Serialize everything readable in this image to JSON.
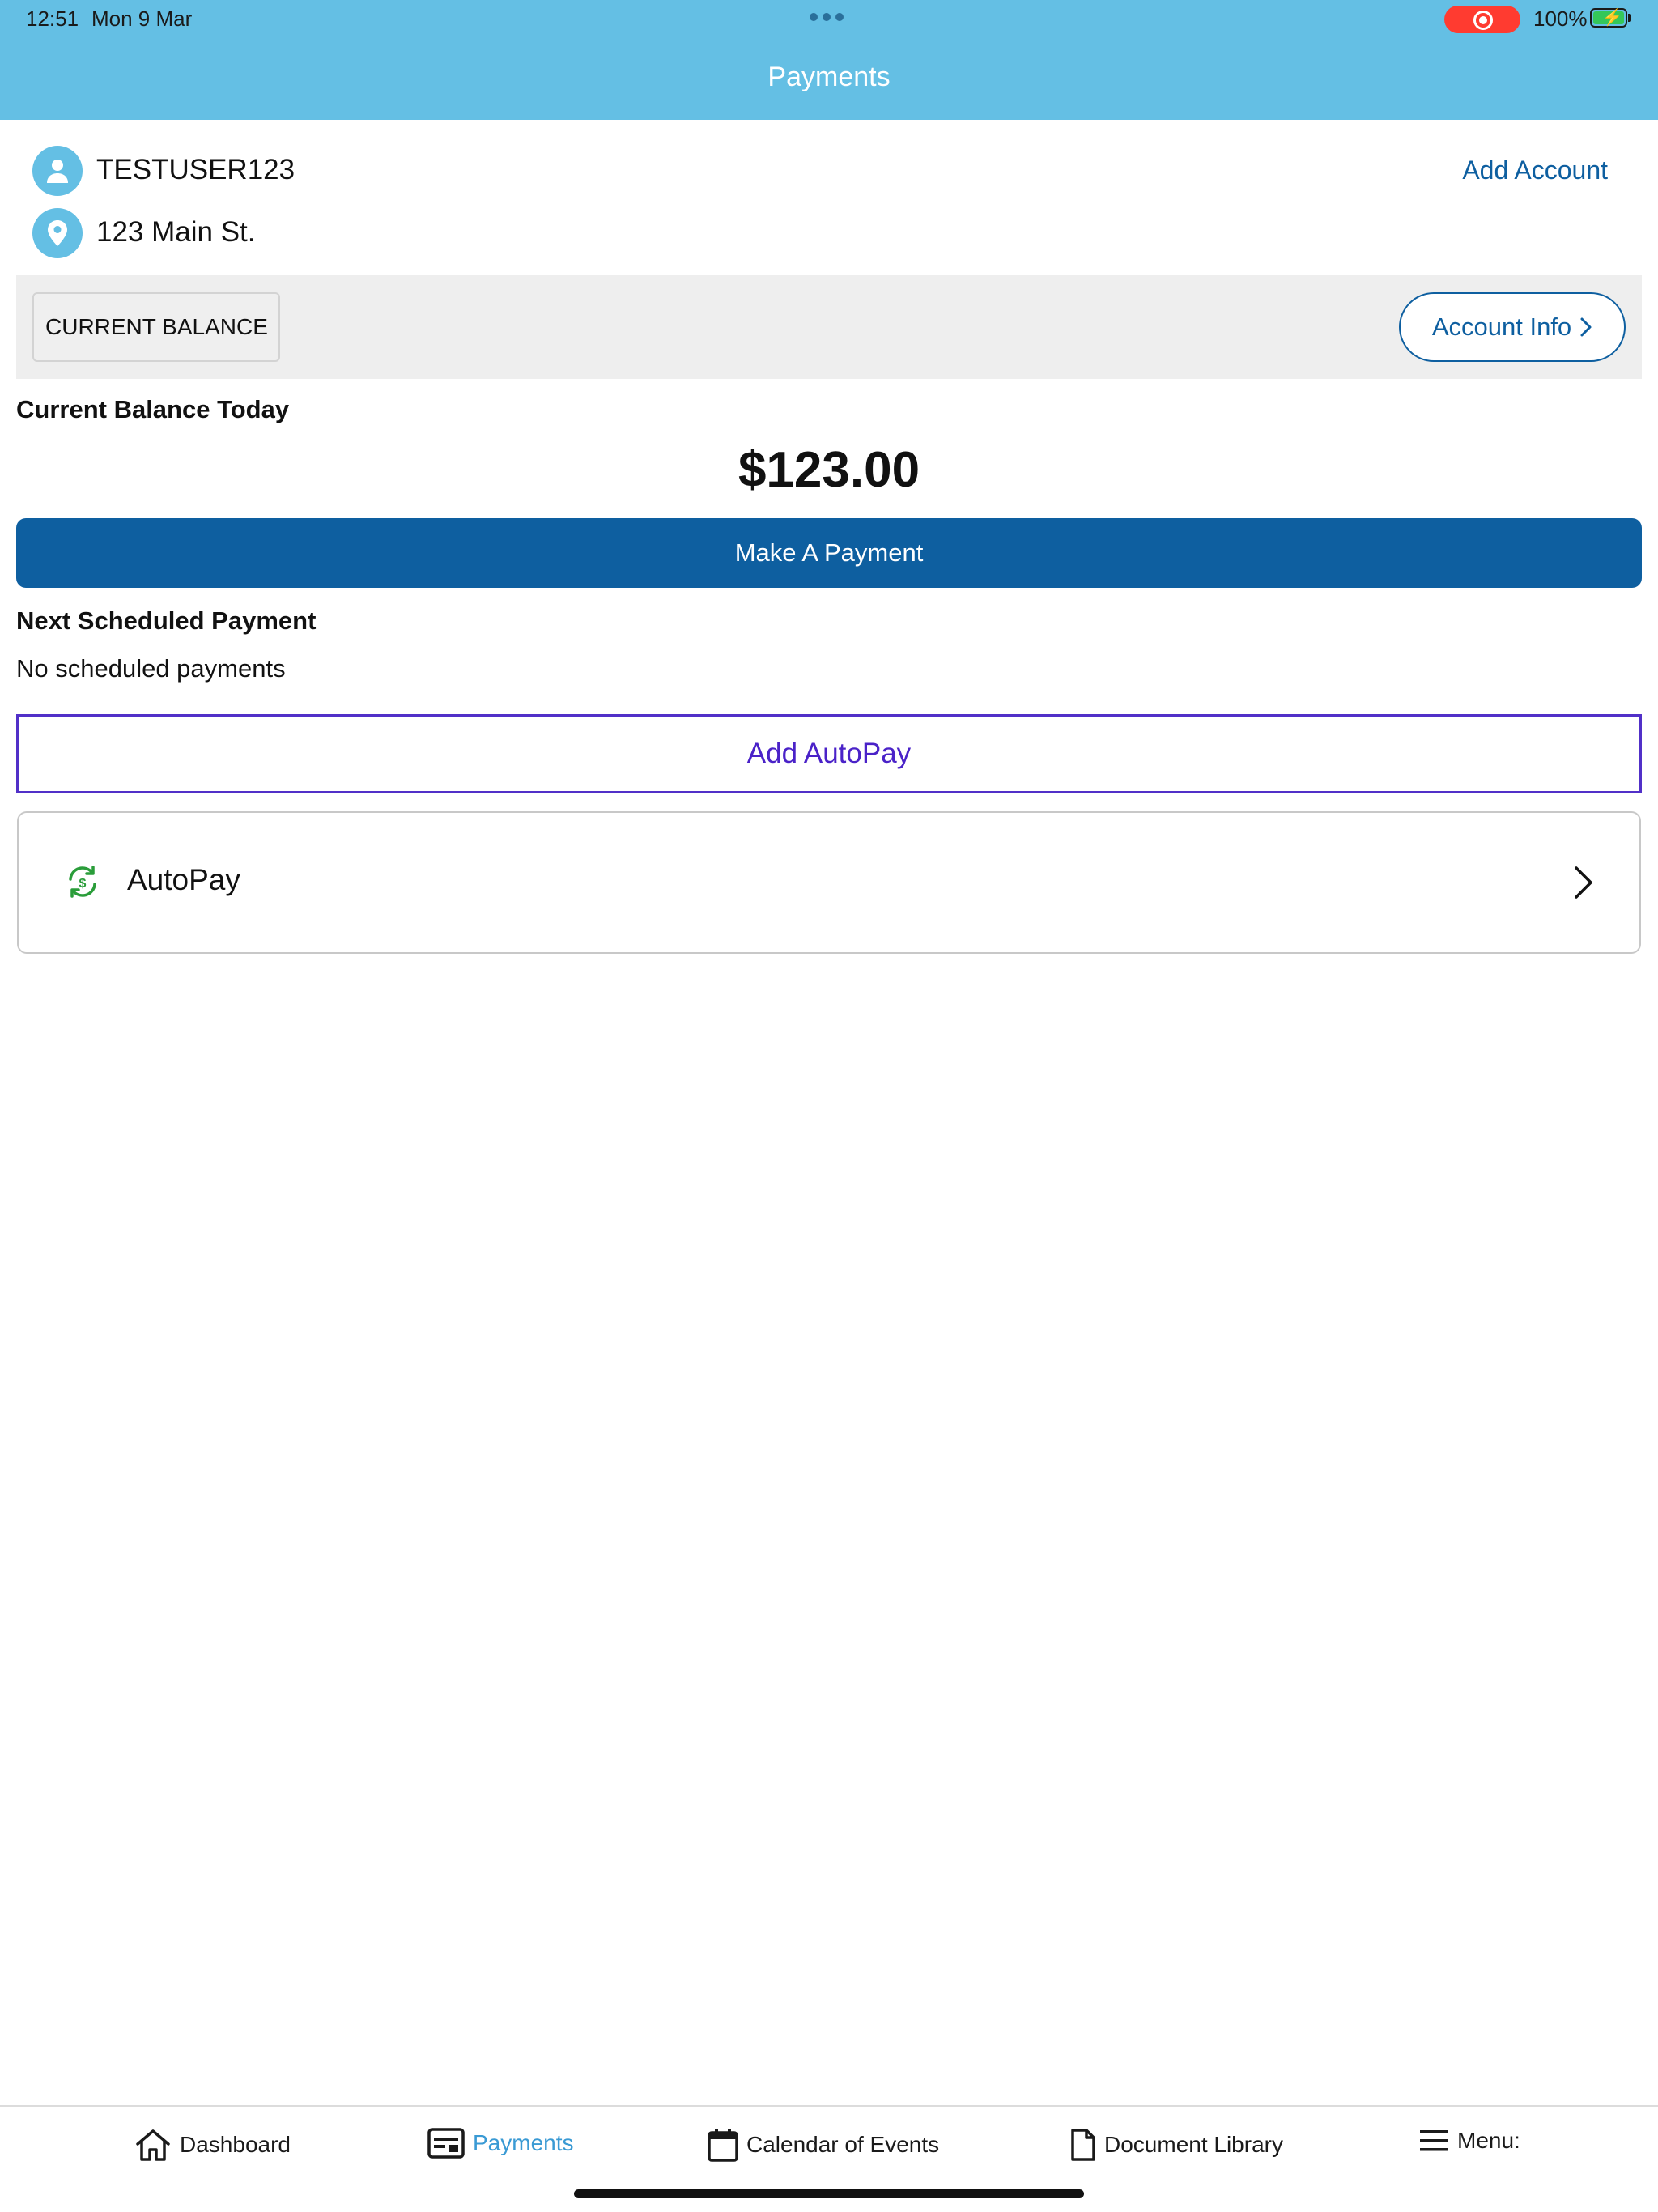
{
  "status_bar": {
    "time": "12:51",
    "date": "Mon 9 Mar",
    "battery": "100%"
  },
  "header": {
    "title": "Payments",
    "background": "#64bfe4"
  },
  "account": {
    "username": "TESTUSER123",
    "address": "123 Main St.",
    "add_account_label": "Add Account",
    "icons": [
      "person-icon",
      "location-pin-icon"
    ]
  },
  "balance_bar": {
    "tab_label": "CURRENT BALANCE",
    "account_info_label": "Account Info"
  },
  "balance": {
    "heading": "Current Balance Today",
    "amount": "$123.00",
    "make_payment_label": "Make A Payment"
  },
  "scheduled": {
    "heading": "Next Scheduled Payment",
    "empty_text": "No scheduled payments",
    "add_autopay_label": "Add AutoPay"
  },
  "autopay_row": {
    "label": "AutoPay",
    "icon": "autopay-refresh-dollar-icon"
  },
  "tabbar": {
    "items": [
      {
        "label": "Dashboard",
        "icon": "home-icon",
        "active": false
      },
      {
        "label": "Payments",
        "icon": "payments-card-icon",
        "active": true
      },
      {
        "label": "Calendar of Events",
        "icon": "calendar-icon",
        "active": false
      },
      {
        "label": "Document Library",
        "icon": "document-icon",
        "active": false
      },
      {
        "label": "Menu:",
        "icon": "hamburger-menu-icon",
        "active": false
      }
    ]
  },
  "colors": {
    "accent_blue": "#0e5fa0",
    "header_blue": "#64bfe4",
    "autopay_purple": "#5130c8",
    "autopay_icon_green": "#2a9d3a",
    "active_tab": "#3a9ad4"
  }
}
